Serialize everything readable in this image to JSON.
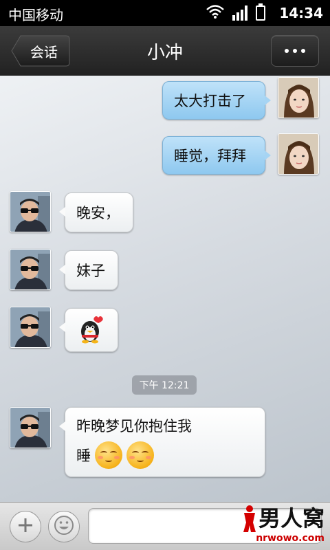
{
  "status_bar": {
    "carrier": "中国移动",
    "time": "14:34",
    "icons": [
      "wifi-icon",
      "signal-icon",
      "battery-icon"
    ]
  },
  "nav": {
    "back_label": "会话",
    "title": "小冲",
    "more_icon": "more-dots-icon"
  },
  "messages": [
    {
      "from": "me",
      "text": "太大打击了"
    },
    {
      "from": "me",
      "text": "睡觉，拜拜"
    },
    {
      "from": "contact",
      "text": "晚安，"
    },
    {
      "from": "contact",
      "text": "妹子"
    },
    {
      "from": "contact",
      "sticker": "qq-penguin-sticker"
    },
    {
      "from": "contact",
      "line1": "昨晚梦见你抱住我",
      "line2": "睡",
      "emojis": [
        "shy-emoji",
        "shy-emoji"
      ]
    }
  ],
  "timestamp": "下午 12:21",
  "input_bar": {
    "add_icon": "plus-icon",
    "emoji_icon": "smiley-icon",
    "input_value": "",
    "input_placeholder": ""
  },
  "watermark": {
    "main": "男人窝",
    "sub": "nrwowo.com"
  },
  "colors": {
    "sent_bubble": "#a6d4f3",
    "received_bubble": "#ffffff",
    "nav_bar": "#2b2b2b"
  }
}
